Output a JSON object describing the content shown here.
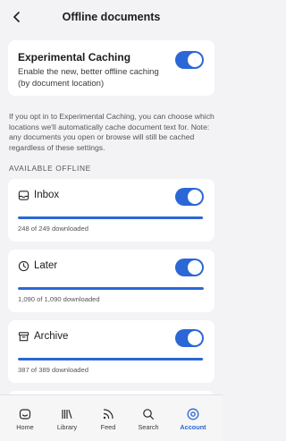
{
  "header": {
    "title": "Offline documents"
  },
  "experimental": {
    "title": "Experimental Caching",
    "description": "Enable the new, better offline caching (by document location)",
    "enabled": true
  },
  "info_text": "If you opt in to Experimental Caching, you can choose which locations we'll automatically cache document text for. Note: any documents you open or browse will still be cached regardless of these settings.",
  "section_label": "AVAILABLE OFFLINE",
  "locations": [
    {
      "name": "Inbox",
      "icon": "inbox-icon",
      "enabled": true,
      "status": "248 of 249 downloaded",
      "progress": 0.996
    },
    {
      "name": "Later",
      "icon": "clock-icon",
      "enabled": true,
      "status": "1,090 of 1,090 downloaded",
      "progress": 1.0
    },
    {
      "name": "Archive",
      "icon": "archive-icon",
      "enabled": true,
      "status": "387 of 389 downloaded",
      "progress": 0.995
    }
  ],
  "tabs": [
    {
      "label": "Home",
      "icon": "home-icon",
      "active": false
    },
    {
      "label": "Library",
      "icon": "library-icon",
      "active": false
    },
    {
      "label": "Feed",
      "icon": "feed-icon",
      "active": false
    },
    {
      "label": "Search",
      "icon": "search-icon",
      "active": false
    },
    {
      "label": "Account",
      "icon": "account-icon",
      "active": true
    }
  ],
  "colors": {
    "accent": "#2b67d6",
    "background": "#f3f3f5",
    "card": "#ffffff"
  }
}
